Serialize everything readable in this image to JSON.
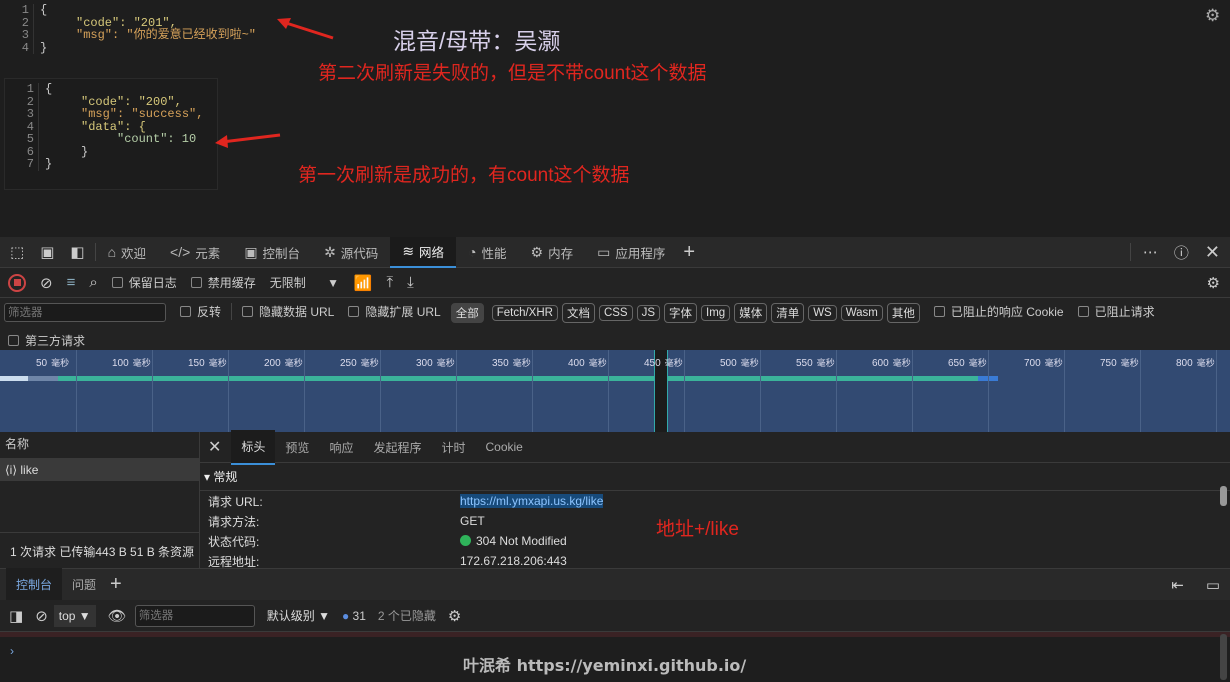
{
  "response2": {
    "lines": [
      "{",
      "\"code\": \"201\",",
      "\"msg\": \"你的爱意已经收到啦~\"",
      "}"
    ]
  },
  "response1": {
    "lines": [
      "{",
      "\"code\": \"200\",",
      "\"msg\": \"success\",",
      "\"data\": {",
      "\"count\": 10",
      "}",
      "}"
    ]
  },
  "annotations": {
    "credit": "混音/母带：吴灏",
    "second": "第二次刷新是失败的，但是不带count这个数据",
    "first": "第一次刷新是成功的，有count这个数据",
    "url_note": "地址+/like",
    "watermark": "叶泯希 https://yeminxi.github.io/"
  },
  "devtools": {
    "tabs": [
      {
        "label": "欢迎",
        "icon": "home-icon"
      },
      {
        "label": "元素",
        "icon": "code-icon"
      },
      {
        "label": "控制台",
        "icon": "console-icon"
      },
      {
        "label": "源代码",
        "icon": "bug-icon"
      },
      {
        "label": "网络",
        "icon": "wifi-icon",
        "active": true
      },
      {
        "label": "性能",
        "icon": "gauge-icon"
      },
      {
        "label": "内存",
        "icon": "chip-icon"
      },
      {
        "label": "应用程序",
        "icon": "app-icon"
      }
    ],
    "toolbar": {
      "preserve_log": "保留日志",
      "disable_cache": "禁用缓存",
      "throttle": "无限制"
    },
    "filter": {
      "placeholder": "筛选器",
      "invert": "反转",
      "hide_data_url": "隐藏数据 URL",
      "hide_ext_url": "隐藏扩展 URL",
      "types": [
        "全部",
        "Fetch/XHR",
        "文档",
        "CSS",
        "JS",
        "字体",
        "Img",
        "媒体",
        "清单",
        "WS",
        "Wasm",
        "其他"
      ],
      "blocked_cookies": "已阻止的响应 Cookie",
      "blocked_requests": "已阻止请求",
      "third_party": "第三方请求"
    },
    "timeline": {
      "unit": "毫秒",
      "ticks": [
        "50",
        "100",
        "150",
        "200",
        "250",
        "300",
        "350",
        "400",
        "450",
        "500",
        "550",
        "600",
        "650",
        "700",
        "750",
        "800"
      ]
    },
    "requests": {
      "header": "名称",
      "items": [
        "like"
      ],
      "status": "1 次请求  已传输443 B  51 B 条资源"
    },
    "details": {
      "tabs": [
        "标头",
        "预览",
        "响应",
        "发起程序",
        "计时",
        "Cookie"
      ],
      "section": "常规",
      "rows": [
        {
          "label": "请求 URL:",
          "value": "https://ml.ymxapi.us.kg/like"
        },
        {
          "label": "请求方法:",
          "value": "GET"
        },
        {
          "label": "状态代码:",
          "value": "304 Not Modified"
        },
        {
          "label": "远程地址:",
          "value": "172.67.218.206:443"
        }
      ],
      "status_color": "#2fb35a"
    },
    "console": {
      "tabs": [
        "控制台",
        "问题"
      ],
      "context": "top",
      "filter_placeholder": "筛选器",
      "level": "默认级别",
      "message_count": "31",
      "hidden": "2 个已隐藏"
    }
  }
}
